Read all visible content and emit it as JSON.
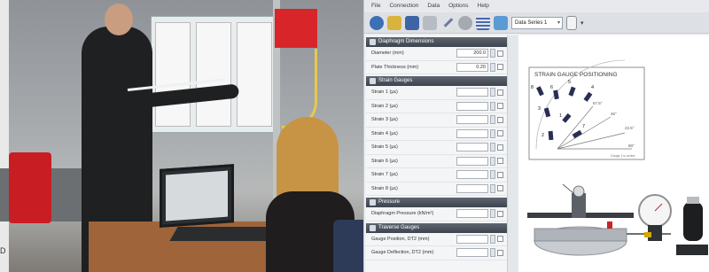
{
  "photo": {
    "caption": "D"
  },
  "window": {
    "menu": [
      "File",
      "Connection",
      "Data",
      "Options",
      "Help"
    ],
    "toolbar": {
      "series_select": "Data Series 1"
    }
  },
  "panel": {
    "sections": [
      {
        "title": "Diaphragm Dimensions",
        "rows": [
          {
            "label": "Diameter (mm)",
            "value": "200.0"
          },
          {
            "label": "Plate Thickness (mm)",
            "value": "0.20"
          }
        ]
      },
      {
        "title": "Strain Gauges",
        "rows": [
          {
            "label": "Strain 1 (μɛ)",
            "value": ""
          },
          {
            "label": "Strain 2 (μɛ)",
            "value": ""
          },
          {
            "label": "Strain 3 (μɛ)",
            "value": ""
          },
          {
            "label": "Strain 4 (μɛ)",
            "value": ""
          },
          {
            "label": "Strain 5 (μɛ)",
            "value": ""
          },
          {
            "label": "Strain 6 (μɛ)",
            "value": ""
          },
          {
            "label": "Strain 7 (μɛ)",
            "value": ""
          },
          {
            "label": "Strain 8 (μɛ)",
            "value": ""
          }
        ]
      },
      {
        "title": "Pressure",
        "rows": [
          {
            "label": "Diaphragm Pressure (kN/m²)",
            "value": ""
          }
        ]
      },
      {
        "title": "Traverse Gauges",
        "rows": [
          {
            "label": "Gauge Position, DT2 (mm)",
            "value": ""
          },
          {
            "label": "Gauge Deflection, DT2 (mm)",
            "value": ""
          }
        ]
      }
    ]
  },
  "diagram": {
    "title": "STRAIN GAUGE POSITIONING",
    "gauge_numbers": [
      "8",
      "6",
      "5",
      "4",
      "3",
      "1",
      "2",
      "7"
    ],
    "angle_labels": [
      "22.5°",
      "45°",
      "67.5°",
      "90°"
    ],
    "caption": "Gauge 1 is centre"
  }
}
